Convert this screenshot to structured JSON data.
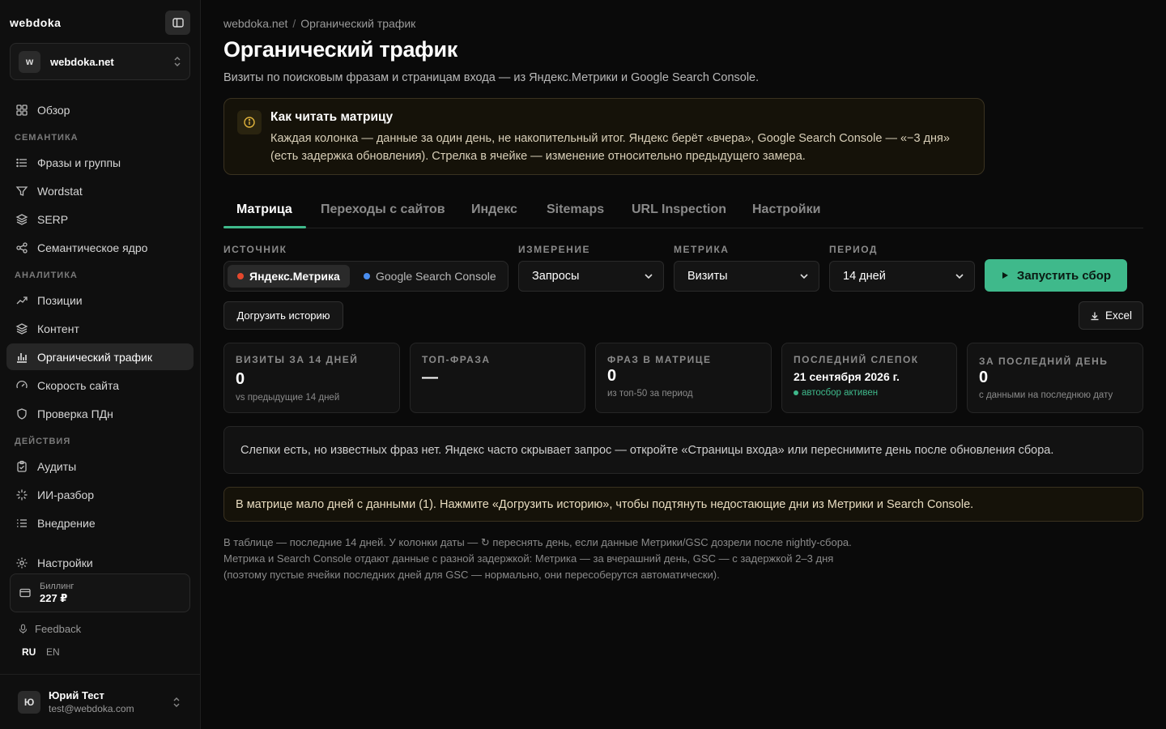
{
  "sidebar": {
    "brand": "webdoka",
    "site": {
      "avatar": "w",
      "name": "webdoka.net"
    },
    "overview": "Обзор",
    "sections": {
      "semantics": "СЕМАНТИКА",
      "analytics": "АНАЛИТИКА",
      "actions": "ДЕЙСТВИЯ"
    },
    "items": {
      "phrases": "Фразы и группы",
      "wordstat": "Wordstat",
      "serp": "SERP",
      "core": "Семантическое ядро",
      "positions": "Позиции",
      "content": "Контент",
      "organic": "Органический трафик",
      "speed": "Скорость сайта",
      "pdn": "Проверка ПДн",
      "audits": "Аудиты",
      "ai": "ИИ-разбор",
      "implementation": "Внедрение",
      "settings": "Настройки"
    },
    "billing": {
      "label": "Биллинг",
      "value": "227 ₽"
    },
    "feedback": "Feedback",
    "lang": {
      "ru": "RU",
      "en": "EN"
    },
    "user": {
      "avatar": "Ю",
      "name": "Юрий Тест",
      "email": "test@webdoka.com"
    }
  },
  "breadcrumb": {
    "site": "webdoka.net",
    "sep": "/",
    "page": "Органический трафик"
  },
  "page": {
    "title": "Органический трафик",
    "subtitle": "Визиты по поисковым фразам и страницам входа — из Яндекс.Метрики и Google Search Console."
  },
  "info": {
    "title": "Как читать матрицу",
    "text": "Каждая колонка — данные за один день, не накопительный итог. Яндекс берёт «вчера», Google Search Console — «−3 дня» (есть задержка обновления). Стрелка в ячейке — изменение относительно предыдущего замера."
  },
  "tabs": [
    "Матрица",
    "Переходы с сайтов",
    "Индекс",
    "Sitemaps",
    "URL Inspection",
    "Настройки"
  ],
  "filters": {
    "source_label": "ИСТОЧНИК",
    "source_yandex": "Яндекс.Метрика",
    "source_google": "Google Search Console",
    "dimension_label": "ИЗМЕРЕНИЕ",
    "dimension_value": "Запросы",
    "metric_label": "МЕТРИКА",
    "metric_value": "Визиты",
    "period_label": "ПЕРИОД",
    "period_value": "14 дней",
    "run_button": "Запустить сбор",
    "history_button": "Догрузить историю",
    "excel_button": "Excel"
  },
  "colors": {
    "accent": "#3fb98b",
    "yandex_dot": "#e5482d",
    "google_dot": "#4a8ef0"
  },
  "stats": [
    {
      "label": "ВИЗИТЫ ЗА 14 ДНЕЙ",
      "value": "0",
      "sub": "vs предыдущие 14 дней"
    },
    {
      "label": "ТОП-ФРАЗА",
      "value": "—",
      "sub": ""
    },
    {
      "label": "ФРАЗ В МАТРИЦЕ",
      "value": "0",
      "sub": "из топ-50 за период"
    },
    {
      "label": "ПОСЛЕДНИЙ СЛЕПОК",
      "value": "21 сентября 2026 г.",
      "sub": "автосбор активен"
    },
    {
      "label": "ЗА ПОСЛЕДНИЙ ДЕНЬ",
      "value": "0",
      "sub": "с данными на последнюю дату"
    }
  ],
  "notice": "Слепки есть, но известных фраз нет. Яндекс часто скрывает запрос — откройте «Страницы входа» или переснимите день после обновления сбора.",
  "warning": "В матрице мало дней с данными (1). Нажмите «Догрузить историю», чтобы подтянуть недостающие дни из Метрики и Search Console.",
  "footnote": [
    "В таблице — последние 14 дней. У колонки даты — ↻ переснять день, если данные Метрики/GSC дозрели после nightly-сбора.",
    "Метрика и Search Console отдают данные с разной задержкой: Метрика — за вчерашний день, GSC — с задержкой 2–3 дня",
    "(поэтому пустые ячейки последних дней для GSC — нормально, они пересоберутся автоматически)."
  ]
}
